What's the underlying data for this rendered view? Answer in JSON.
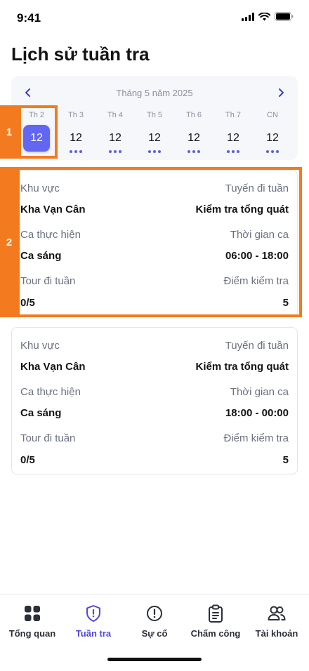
{
  "status_bar": {
    "time": "9:41"
  },
  "page": {
    "title": "Lịch sử tuần tra"
  },
  "calendar": {
    "month_label": "Tháng 5 năm 2025",
    "days": [
      {
        "name": "Th 2",
        "date": "12",
        "selected": true
      },
      {
        "name": "Th 3",
        "date": "12"
      },
      {
        "name": "Th 4",
        "date": "12"
      },
      {
        "name": "Th 5",
        "date": "12"
      },
      {
        "name": "Th 6",
        "date": "12"
      },
      {
        "name": "Th 7",
        "date": "12"
      },
      {
        "name": "CN",
        "date": "12"
      }
    ]
  },
  "markers": [
    "1",
    "2"
  ],
  "cards": [
    {
      "area_label": "Khu vực",
      "area": "Kha Vạn Cân",
      "route_label": "Tuyến đi tuần",
      "route": "Kiểm tra tổng quát",
      "shift_label": "Ca thực hiện",
      "shift": "Ca sáng",
      "time_label": "Thời gian ca",
      "time": "06:00 - 18:00",
      "tour_label": "Tour đi tuần",
      "tour": "0/5",
      "checkpoint_label": "Điểm kiểm tra",
      "checkpoint": "5"
    },
    {
      "area_label": "Khu vực",
      "area": "Kha Vạn Cân",
      "route_label": "Tuyến đi tuần",
      "route": "Kiểm tra tổng quát",
      "shift_label": "Ca thực hiện",
      "shift": "Ca sáng",
      "time_label": "Thời gian ca",
      "time": "18:00 - 00:00",
      "tour_label": "Tour đi tuần",
      "tour": "0/5",
      "checkpoint_label": "Điểm kiểm tra",
      "checkpoint": "5"
    }
  ],
  "nav": {
    "items": [
      {
        "label": "Tổng quan",
        "icon": "grid-icon"
      },
      {
        "label": "Tuần tra",
        "icon": "shield-alert-icon",
        "active": true
      },
      {
        "label": "Sự cố",
        "icon": "alert-circle-icon"
      },
      {
        "label": "Chấm công",
        "icon": "clipboard-icon"
      },
      {
        "label": "Tài khoản",
        "icon": "users-icon"
      }
    ]
  },
  "colors": {
    "accent": "#6366f1",
    "nav_active": "#4f46e5",
    "marker": "#f47a20"
  }
}
